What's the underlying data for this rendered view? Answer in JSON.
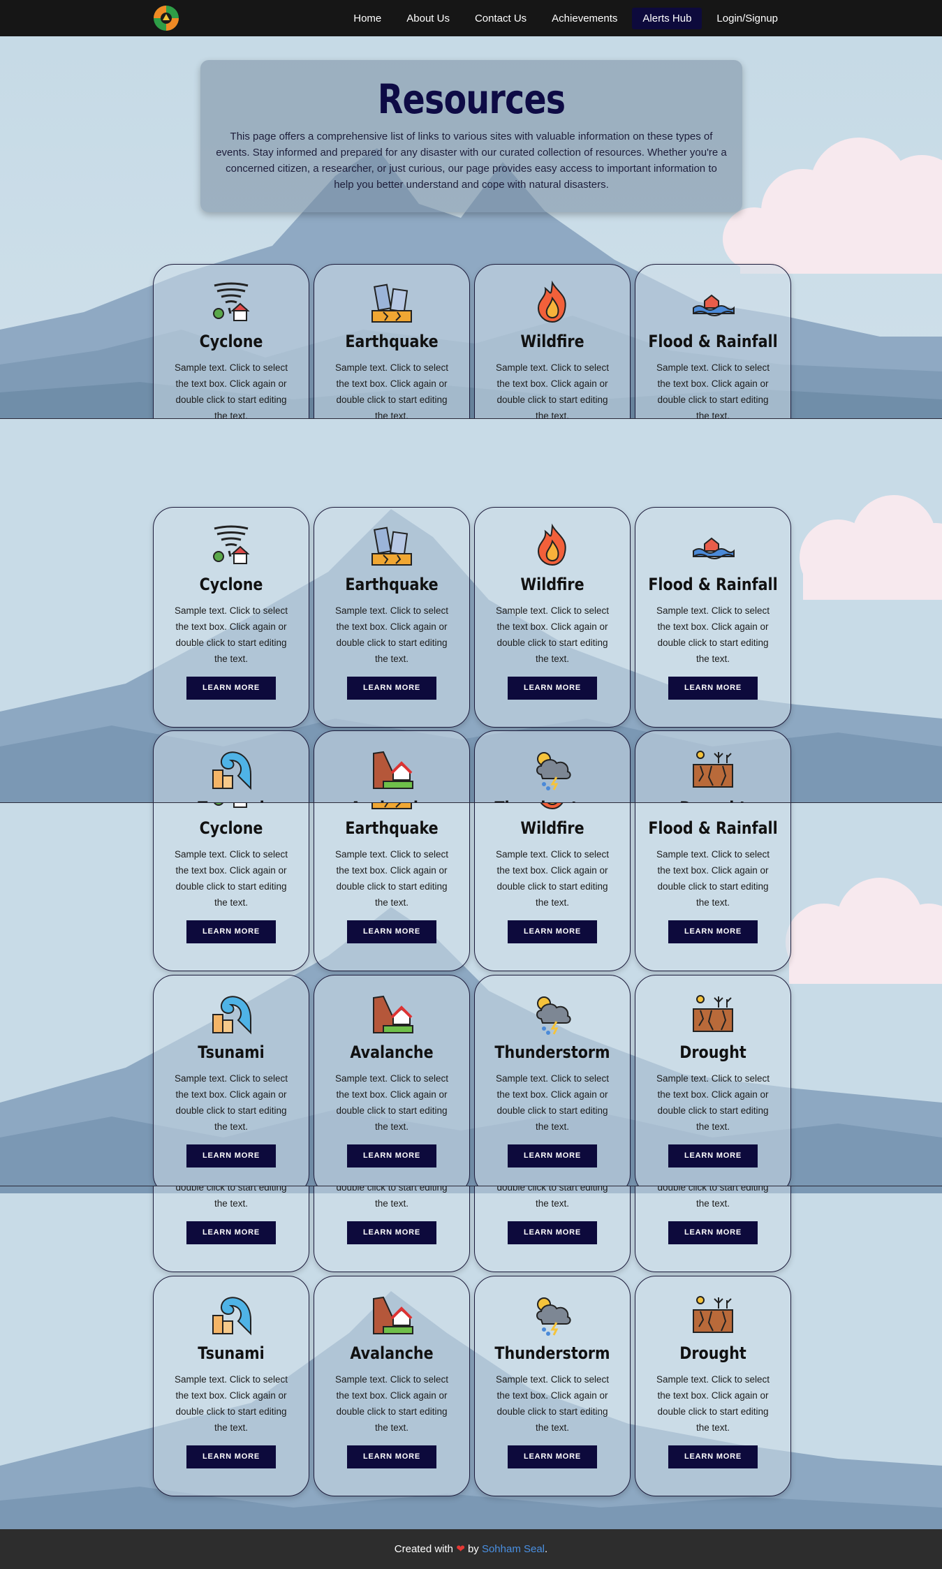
{
  "nav": {
    "links": [
      "Home",
      "About Us",
      "Contact Us",
      "Achievements",
      "Alerts Hub",
      "Login/Signup"
    ],
    "active_index": 4
  },
  "hero": {
    "title": "Resources",
    "description": "This page offers a comprehensive list of links to various sites with valuable information on these types of events. Stay informed and prepared for any disaster with our curated collection of resources. Whether you're a concerned citizen, a researcher, or just curious, our page provides easy access to important information to help you better understand and cope with natural disasters.",
    "last_line": "important information to help you better understand and cope with natural disasters."
  },
  "card_text": "Sample text. Click to select the text box. Click again or double click to start editing the text.",
  "card_text_tail": "double click to start editing the text.",
  "button_label": "LEARN MORE",
  "cards_row_a": [
    {
      "title": "Cyclone",
      "icon": "cyclone-icon"
    },
    {
      "title": "Earthquake",
      "icon": "earthquake-icon"
    },
    {
      "title": "Wildfire",
      "icon": "wildfire-icon"
    },
    {
      "title": "Flood & Rainfall",
      "icon": "flood-icon"
    }
  ],
  "cards_row_b": [
    {
      "title": "Tsunami",
      "icon": "tsunami-icon"
    },
    {
      "title": "Avalanche",
      "icon": "avalanche-icon"
    },
    {
      "title": "Thunderstorm",
      "icon": "thunderstorm-icon"
    },
    {
      "title": "Drought",
      "icon": "drought-icon"
    }
  ],
  "footer": {
    "prefix": "Created with",
    "by": "by",
    "author": "Sohham Seal",
    "suffix": "."
  }
}
